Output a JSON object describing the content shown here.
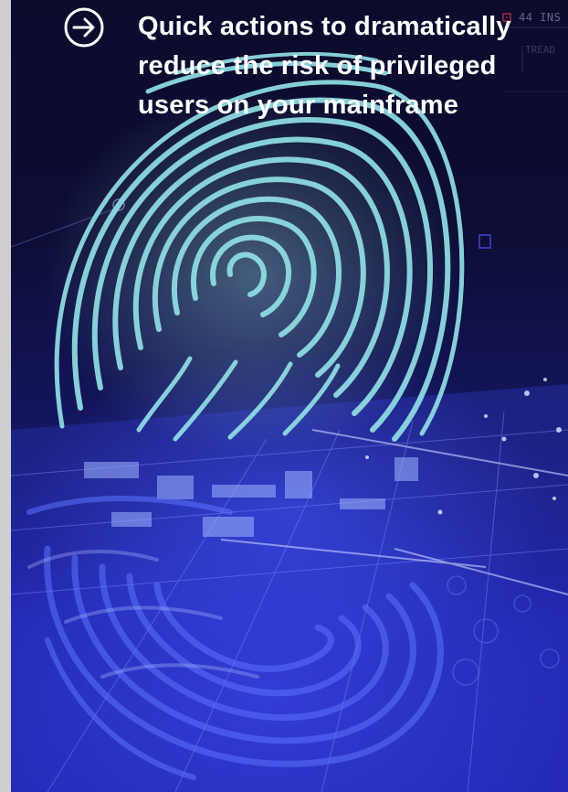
{
  "hero": {
    "headline": "Quick actions to dramatically reduce the risk of privileged users on your mainframe",
    "hud_badge": "44 INS",
    "hud_sub": "TREAD"
  },
  "icons": {
    "arrow": "arrow-right-circle-icon",
    "hud_marker": "square-marker-icon"
  },
  "colors": {
    "background_top": "#0b0b2c",
    "background_bottom": "#2228b4",
    "fingerprint": "#8fe0e4",
    "accent_red": "#e0314d",
    "headline_text": "#ffffff"
  }
}
